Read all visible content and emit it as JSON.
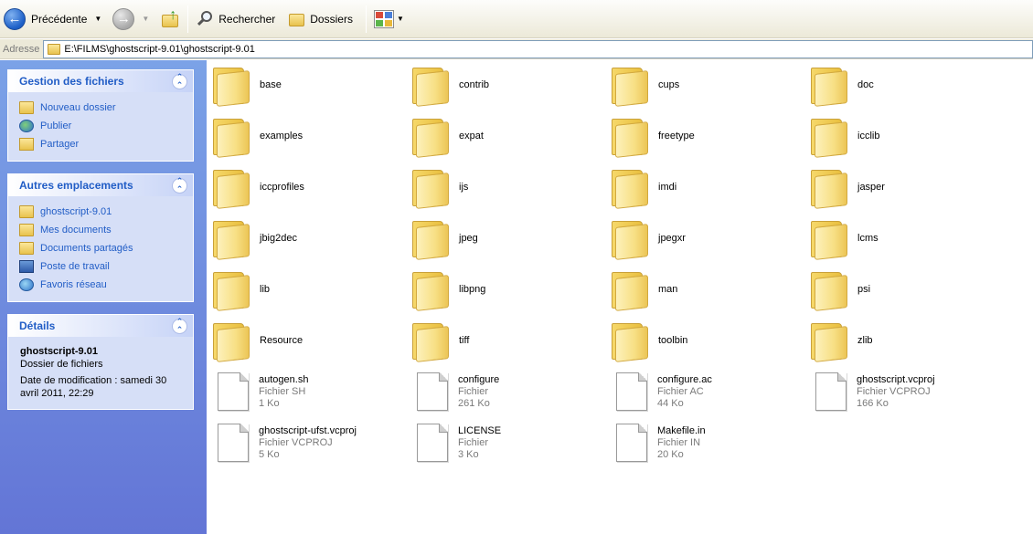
{
  "toolbar": {
    "back_label": "Précédente",
    "search_label": "Rechercher",
    "folders_label": "Dossiers"
  },
  "address": {
    "label": "Adresse",
    "path": "E:\\FILMS\\ghostscript-9.01\\ghostscript-9.01"
  },
  "taskpane": {
    "file_tasks": {
      "title": "Gestion des fichiers",
      "items": [
        "Nouveau dossier",
        "Publier",
        "Partager"
      ]
    },
    "other_places": {
      "title": "Autres emplacements",
      "items": [
        "ghostscript-9.01",
        "Mes documents",
        "Documents partagés",
        "Poste de travail",
        "Favoris réseau"
      ]
    },
    "details": {
      "title": "Détails",
      "name": "ghostscript-9.01",
      "type": "Dossier de fichiers",
      "modified": "Date de modification : samedi 30 avril 2011, 22:29"
    }
  },
  "content": {
    "folders": [
      "base",
      "contrib",
      "cups",
      "doc",
      "examples",
      "expat",
      "freetype",
      "icclib",
      "iccprofiles",
      "ijs",
      "imdi",
      "jasper",
      "jbig2dec",
      "jpeg",
      "jpegxr",
      "lcms",
      "lib",
      "libpng",
      "man",
      "psi",
      "Resource",
      "tiff",
      "toolbin",
      "zlib"
    ],
    "files": [
      {
        "name": "autogen.sh",
        "type": "Fichier SH",
        "size": "1 Ko"
      },
      {
        "name": "configure",
        "type": "Fichier",
        "size": "261 Ko"
      },
      {
        "name": "configure.ac",
        "type": "Fichier AC",
        "size": "44 Ko"
      },
      {
        "name": "ghostscript.vcproj",
        "type": "Fichier VCPROJ",
        "size": "166 Ko"
      },
      {
        "name": "ghostscript-ufst.vcproj",
        "type": "Fichier VCPROJ",
        "size": "5 Ko"
      },
      {
        "name": "LICENSE",
        "type": "Fichier",
        "size": "3 Ko"
      },
      {
        "name": "Makefile.in",
        "type": "Fichier IN",
        "size": "20 Ko"
      }
    ]
  }
}
